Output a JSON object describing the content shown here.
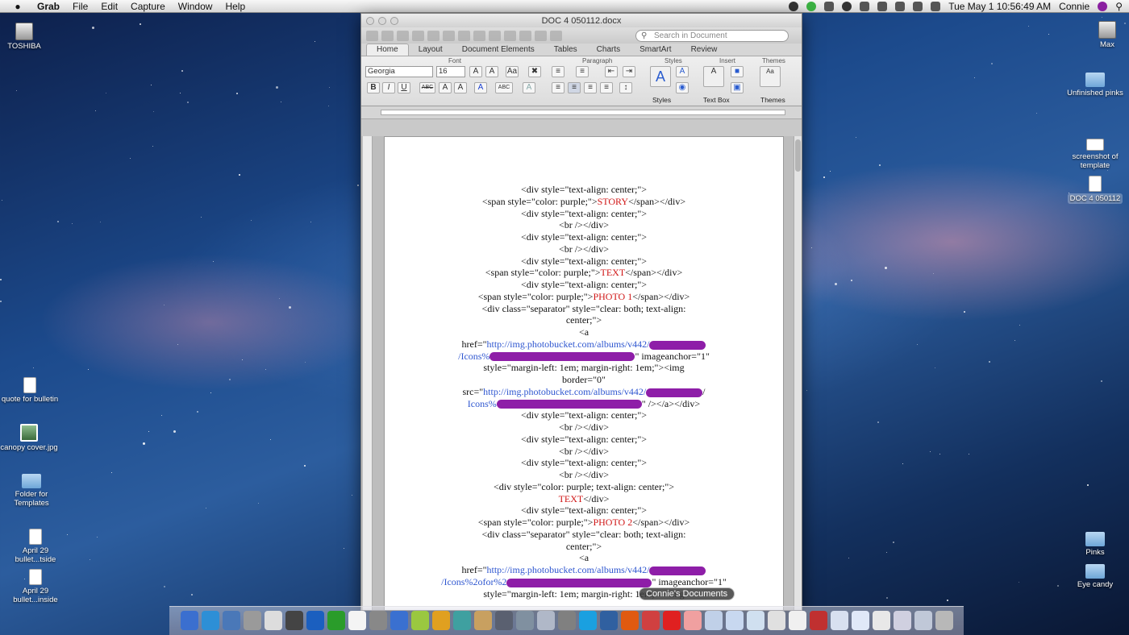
{
  "menubar": {
    "app": "Grab",
    "items": [
      "File",
      "Edit",
      "Capture",
      "Window",
      "Help"
    ],
    "clock": "Tue May 1  10:56:49 AM",
    "user": "Connie"
  },
  "desktop": {
    "left_icons": [
      {
        "label": "TOSHIBA",
        "icon": "drive-icon"
      },
      {
        "label": "quote for bulletin",
        "icon": "document-icon"
      },
      {
        "label": "canopy cover.jpg",
        "icon": "image-file-icon"
      },
      {
        "label": "Folder for Templates",
        "icon": "folder-icon"
      },
      {
        "label": "April 29 bullet...tside",
        "icon": "docx-icon"
      },
      {
        "label": "April 29 bullet...inside",
        "icon": "docx-icon"
      }
    ],
    "right_icons": [
      {
        "label": "Max",
        "icon": "drive-icon"
      },
      {
        "label": "Unfinished pinks",
        "icon": "folder-icon"
      },
      {
        "label": "screenshot of template",
        "icon": "screenshot-icon"
      },
      {
        "label": "DOC 4 050112",
        "icon": "docx-icon"
      },
      {
        "label": "Pinks",
        "icon": "folder-icon"
      },
      {
        "label": "Eye candy",
        "icon": "folder-icon"
      }
    ]
  },
  "word": {
    "title": "DOC 4 050112.docx",
    "search_placeholder": "Search in Document",
    "tabs": [
      "Home",
      "Layout",
      "Document Elements",
      "Tables",
      "Charts",
      "SmartArt",
      "Review"
    ],
    "groups": {
      "font": "Font",
      "paragraph": "Paragraph",
      "styles": "Styles",
      "insert": "Insert",
      "themes": "Themes"
    },
    "font_name": "Georgia",
    "font_size": "16",
    "styles_label": "Styles",
    "textbox_label": "Text Box",
    "themes_label": "Themes",
    "doc_lines": [
      {
        "t": "<div style=\"text-align: center;\">"
      },
      {
        "t": "<span style=\"color: purple;\">",
        "r": "STORY",
        "e": "</span></div>"
      },
      {
        "t": "<div style=\"text-align: center;\">"
      },
      {
        "t": "<br /></div>"
      },
      {
        "t": "<div style=\"text-align: center;\">"
      },
      {
        "t": "<br /></div>"
      },
      {
        "t": "<div style=\"text-align: center;\">"
      },
      {
        "t": "<span style=\"color: purple;\">",
        "r": "TEXT",
        "e": "</span></div>"
      },
      {
        "t": "<div style=\"text-align: center;\">"
      },
      {
        "t": "<span style=\"color: purple;\">",
        "r": "PHOTO 1",
        "e": "</span></div>"
      },
      {
        "t": "<div class=\"separator\" style=\"clear: both; text-align:"
      },
      {
        "t": "center;\">"
      },
      {
        "t": "<a"
      },
      {
        "t": "href=\"",
        "l": "http://img.photobucket.com/albums/v442/",
        "x": 1
      },
      {
        "l": "/Icons%",
        "x": 2,
        "e": "\" imageanchor=\"1\""
      },
      {
        "t": "style=\"margin-left: 1em; margin-right: 1em;\"><img"
      },
      {
        "t": "border=\"0\""
      },
      {
        "t": "src=\"",
        "l": "http://img.photobucket.com/albums/v442/",
        "x": 1,
        "e": "/"
      },
      {
        "l": "Icons%",
        "x": 2,
        "e": "\" /></a></div>"
      },
      {
        "t": "<div style=\"text-align: center;\">"
      },
      {
        "t": "<br /></div>"
      },
      {
        "t": "<div style=\"text-align: center;\">"
      },
      {
        "t": "<br /></div>"
      },
      {
        "t": "<div style=\"text-align: center;\">"
      },
      {
        "t": "<br /></div>"
      },
      {
        "t": "<div style=\"color: purple; text-align: center;\">"
      },
      {
        "r": "TEXT",
        "e": "</div>"
      },
      {
        "t": "<div style=\"text-align: center;\">"
      },
      {
        "t": "<span style=\"color: purple;\">",
        "r": "PHOTO 2",
        "e": "</span></div>"
      },
      {
        "t": "<div class=\"separator\" style=\"clear: both; text-align:"
      },
      {
        "t": "center;\">"
      },
      {
        "t": "<a"
      },
      {
        "t": "href=\"",
        "l": "http://img.photobucket.com/albums/v442/",
        "x": 1
      },
      {
        "l": "/Icons%2ofor%2",
        "x": 2,
        "e": "\" imageanchor=\"1\""
      },
      {
        "t": "style=\"margin-left: 1em; margin-right: 1em;\"><img"
      }
    ]
  },
  "dock": {
    "tooltip": "Connie's Documents",
    "colors": [
      "#3b6fcf",
      "#2d8fd6",
      "#4a78b8",
      "#9a9a9a",
      "#dddddd",
      "#444444",
      "#1b5fbf",
      "#2a9c2a",
      "#f4f4f4",
      "#888888",
      "#3a70d0",
      "#9ac840",
      "#e0a020",
      "#3fa0a0",
      "#c8a060",
      "#5a6070",
      "#8090a0",
      "#b0b8c8",
      "#808080",
      "#1aa0e0",
      "#3060a0",
      "#e05a10",
      "#d04040",
      "#e02020",
      "#f0a0a0",
      "#c0d0e8",
      "#c8d8f0",
      "#d0e0f0",
      "#e0e0e0",
      "#f0f0f0",
      "#c03030",
      "#d8e0f0",
      "#e0e8f8",
      "#e8e8e8",
      "#d0d0e0",
      "#c0c8d8",
      "#b8b8b8"
    ]
  }
}
